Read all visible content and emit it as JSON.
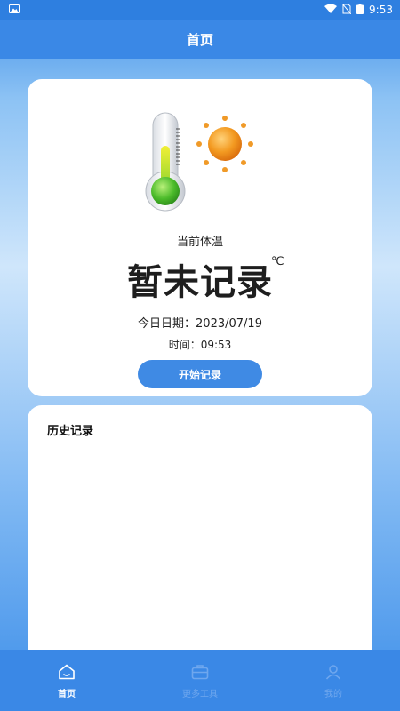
{
  "status_bar": {
    "time": "9:53",
    "icons": [
      "image-icon",
      "wifi-icon",
      "no-sim-icon",
      "battery-icon"
    ]
  },
  "app_bar": {
    "title": "首页"
  },
  "temperature_card": {
    "illustration": [
      "thermometer-icon",
      "sun-icon"
    ],
    "current_label": "当前体温",
    "value": "暂未记录",
    "unit": "℃",
    "date_line": "今日日期：2023/07/19",
    "time_line": "时间：09:53",
    "start_button": "开始记录"
  },
  "history": {
    "title": "历史记录"
  },
  "tabbar": {
    "tabs": [
      {
        "label": "首页",
        "icon": "home-icon",
        "active": true
      },
      {
        "label": "更多工具",
        "icon": "toolbox-icon",
        "active": false
      },
      {
        "label": "我的",
        "icon": "user-icon",
        "active": false
      }
    ]
  },
  "colors": {
    "primary": "#3a88e6",
    "button": "#3f8ae4",
    "inactive_tab": "#6fa7ee"
  }
}
